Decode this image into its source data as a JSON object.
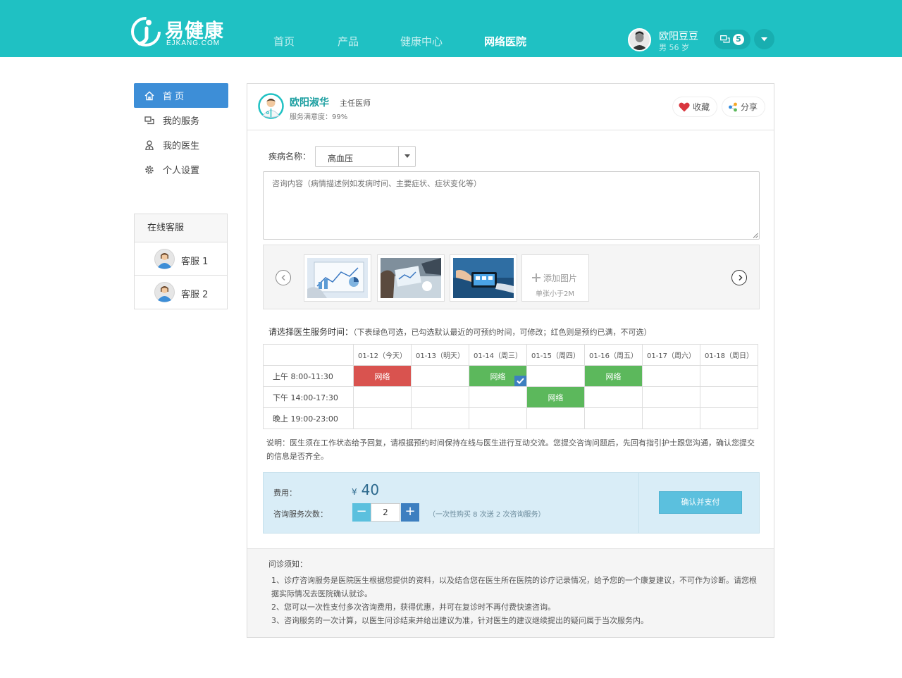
{
  "brand": {
    "name_cn": "易健康",
    "name_en": "EJKANG.COM",
    "color": "#1fc1c3"
  },
  "nav": {
    "items": [
      {
        "label": "首页"
      },
      {
        "label": "产品"
      },
      {
        "label": "健康中心"
      },
      {
        "label": "网络医院",
        "active": true
      }
    ]
  },
  "user": {
    "name": "欧阳豆豆",
    "meta": "男  56 岁",
    "unread": "5"
  },
  "sidebar": {
    "items": [
      {
        "label": "首 页",
        "active": true
      },
      {
        "label": "我的服务"
      },
      {
        "label": "我的医生"
      },
      {
        "label": "个人设置"
      }
    ]
  },
  "customer_service": {
    "title": "在线客服",
    "agents": [
      {
        "label": "客服 1"
      },
      {
        "label": "客服 2"
      }
    ]
  },
  "doctor": {
    "name": "欧阳淑华",
    "title": "主任医师",
    "satisfaction": "服务满意度：99%"
  },
  "actions": {
    "favorite": "收藏",
    "share": "分享"
  },
  "form": {
    "disease_label": "疾病名称：",
    "disease_value": "高血压",
    "consult_placeholder": "咨询内容（病情描述例如发病时间、主要症状、症状变化等）",
    "add_image": "添加图片",
    "add_image_hint": "单张小于2M"
  },
  "schedule": {
    "hint_title": "请选择医生服务时间：",
    "hint_text": "（下表绿色可选，已勾选默认最近的可预约时间，可修改；红色则是预约已满，不可选）",
    "days": [
      "01-12（今天）",
      "01-13（明天）",
      "01-14（周三）",
      "01-15（周四）",
      "01-16（周五）",
      "01-17（周六）",
      "01-18（周日）"
    ],
    "rows": [
      {
        "label": "上午 8:00-11:30",
        "cells": [
          {
            "text": "网络",
            "state": "full"
          },
          {
            "text": "",
            "state": "none"
          },
          {
            "text": "网络",
            "state": "selected"
          },
          {
            "text": "",
            "state": "none"
          },
          {
            "text": "网络",
            "state": "available"
          },
          {
            "text": "",
            "state": "none"
          },
          {
            "text": "",
            "state": "none"
          }
        ]
      },
      {
        "label": "下午 14:00-17:30",
        "cells": [
          {
            "text": "",
            "state": "none"
          },
          {
            "text": "",
            "state": "none"
          },
          {
            "text": "",
            "state": "none"
          },
          {
            "text": "网络",
            "state": "available"
          },
          {
            "text": "",
            "state": "none"
          },
          {
            "text": "",
            "state": "none"
          },
          {
            "text": "",
            "state": "none"
          }
        ]
      },
      {
        "label": "晚上 19:00-23:00",
        "cells": [
          {
            "text": "",
            "state": "none"
          },
          {
            "text": "",
            "state": "none"
          },
          {
            "text": "",
            "state": "none"
          },
          {
            "text": "",
            "state": "none"
          },
          {
            "text": "",
            "state": "none"
          },
          {
            "text": "",
            "state": "none"
          },
          {
            "text": "",
            "state": "none"
          }
        ]
      }
    ],
    "colors": {
      "full": "#d9534f",
      "available": "#5cb85c",
      "check": "#3d7fc0"
    }
  },
  "note": "说明：医生须在工作状态给予回复，请根据预约时间保持在线与医生进行互动交流。您提交咨询问题后，先回有指引护士跟您沟通，确认您提交的信息是否齐全。",
  "payment": {
    "fee_label": "费用：",
    "currency": "¥",
    "price": "40",
    "count_label": "咨询服务次数：",
    "count": "2",
    "promo": "（一次性购买 8 次送 2 次咨询服务）",
    "confirm": "确认并支付"
  },
  "notice": {
    "title": "问诊须知：",
    "lines": [
      "1、诊疗咨询服务是医院医生根据您提供的资料，以及结合您在医生所在医院的诊疗记录情况，给予您的一个康复建议，不可作为诊断。请您根据实际情况去医院确认就诊。",
      "2、您可以一次性支付多次咨询费用，获得优惠，并可在复诊时不再付费快速咨询。",
      "3、咨询服务的一次计算，以医生问诊结束并给出建议为准，针对医生的建议继续提出的疑问属于当次服务内。"
    ]
  }
}
